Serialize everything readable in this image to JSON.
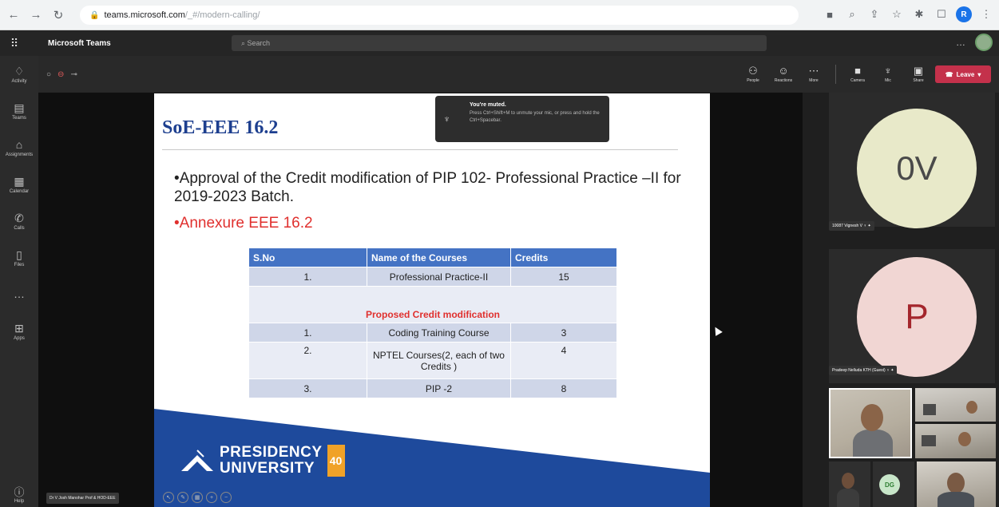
{
  "browser": {
    "url_host": "teams.microsoft.com",
    "url_path": "/_#/modern-calling/",
    "profile_initial": "R"
  },
  "teams": {
    "app_name": "Microsoft Teams",
    "search_placeholder": "Search"
  },
  "rail": {
    "items": [
      {
        "label": "Activity",
        "icon": "bell-icon"
      },
      {
        "label": "Teams",
        "icon": "teams-icon"
      },
      {
        "label": "Assignments",
        "icon": "assignments-icon"
      },
      {
        "label": "Calendar",
        "icon": "calendar-icon"
      },
      {
        "label": "Calls",
        "icon": "phone-icon"
      },
      {
        "label": "Files",
        "icon": "file-icon"
      },
      {
        "label": "",
        "icon": "more-icon"
      },
      {
        "label": "Apps",
        "icon": "apps-icon"
      }
    ],
    "help_label": "Help"
  },
  "meeting_bar": {
    "tools": [
      {
        "label": "People",
        "icon": "people-icon"
      },
      {
        "label": "Reactions",
        "icon": "reactions-icon"
      },
      {
        "label": "More",
        "icon": "more-icon"
      },
      {
        "label": "Camera",
        "icon": "camera-icon"
      },
      {
        "label": "Mic",
        "icon": "mic-icon"
      },
      {
        "label": "Share",
        "icon": "share-icon"
      }
    ],
    "leave_label": "Leave"
  },
  "toast": {
    "title": "You're muted.",
    "body": "Press Ctrl+Shift+M to unmute your mic, or press and hold the Ctrl+Spacebar."
  },
  "slide": {
    "title": "SoE-EEE 16.2",
    "bullet1": "•Approval of the Credit modification of PIP 102- Professional Practice –II for 2019-2023 Batch.",
    "bullet2": "•Annexure EEE 16.2",
    "table": {
      "headers": [
        "S.No",
        "Name of the Courses",
        "Credits"
      ],
      "row1": [
        "1.",
        "Professional Practice-II",
        "15"
      ],
      "proposed": "Proposed Credit modification",
      "rows": [
        [
          "1.",
          "Coding Training Course",
          "3"
        ],
        [
          "2.",
          "NPTEL Courses(2, each of two Credits )",
          "4"
        ],
        [
          "3.",
          "PIP -2",
          "8"
        ]
      ]
    },
    "logo_line1": "PRESIDENCY",
    "logo_line2": "UNIVERSITY",
    "logo_badge": "40",
    "brand_colors": {
      "band": "#1e4a9c",
      "accent": "#f0a228"
    }
  },
  "presenter": {
    "name": "Dr V Josh Manohar Prof & HOD-EEE"
  },
  "participants": {
    "p1_initials": "0V",
    "p1_name": "10087 Vignesh V",
    "p2_initials": "P",
    "p2_name": "Pradeep Nelluda KTH (Guest)",
    "p3_initials": "DG"
  }
}
